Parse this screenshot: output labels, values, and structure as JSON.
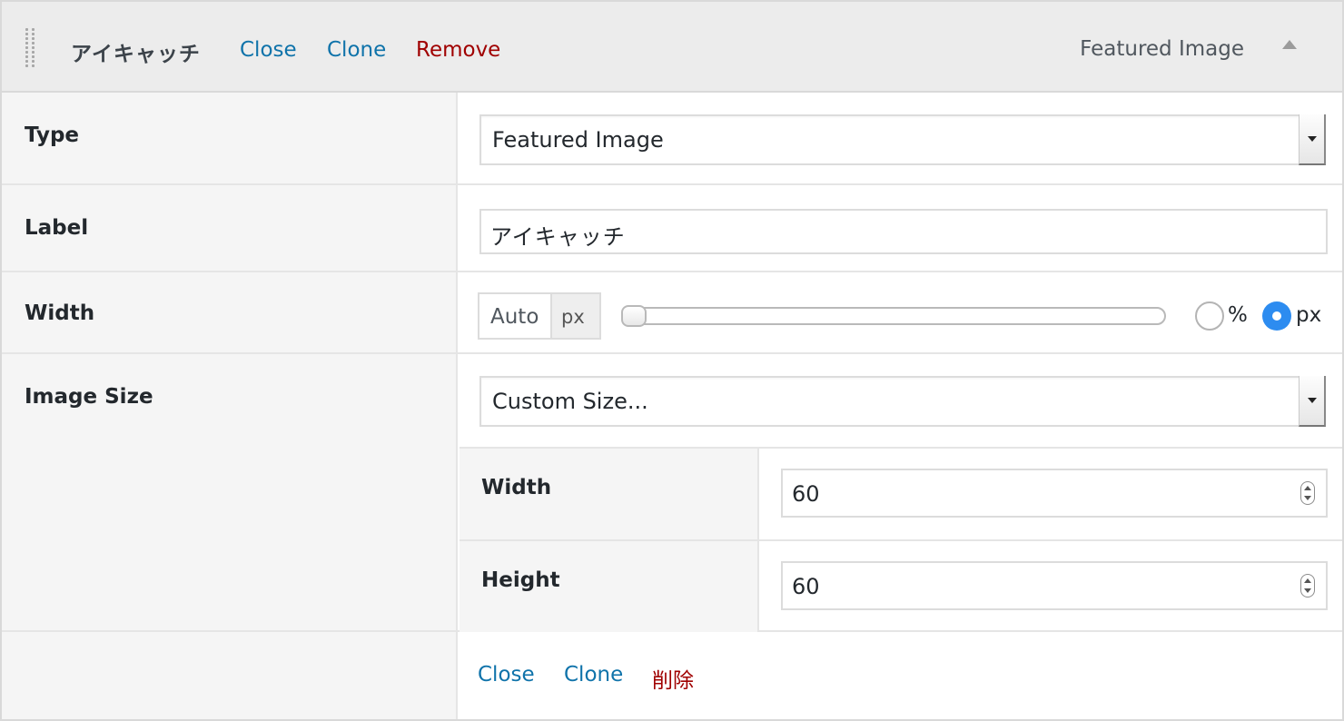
{
  "header": {
    "title": "アイキャッチ",
    "close_label": "Close",
    "clone_label": "Clone",
    "remove_label": "Remove",
    "type_name": "Featured Image"
  },
  "fields": {
    "type": {
      "label": "Type",
      "value": "Featured Image"
    },
    "label": {
      "label": "Label",
      "value": "アイキャッチ"
    },
    "width": {
      "label": "Width",
      "auto_label": "Auto",
      "unit_label": "px",
      "slider_level": 0,
      "unit_options": [
        {
          "label": "%",
          "selected": false
        },
        {
          "label": "px",
          "selected": true
        }
      ]
    },
    "image_size": {
      "label": "Image Size",
      "value": "Custom Size...",
      "width": {
        "label": "Width",
        "value": "60"
      },
      "height": {
        "label": "Height",
        "value": "60"
      }
    }
  },
  "footer": {
    "close_label": "Close",
    "clone_label": "Clone",
    "delete_label": "削除"
  },
  "colors": {
    "link": "#0f73aa",
    "danger": "#a00000",
    "radio_selected": "#2d8cf0"
  }
}
